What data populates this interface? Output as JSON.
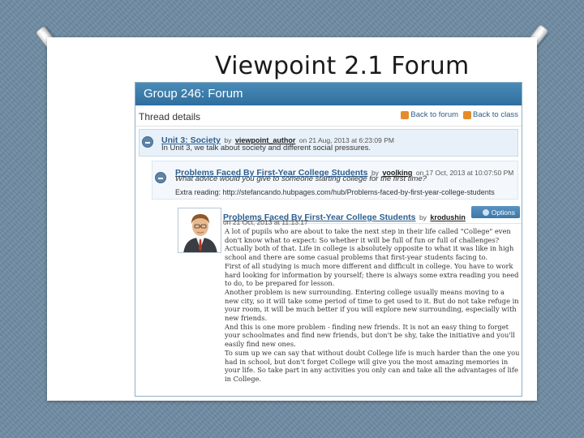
{
  "slide": {
    "title": "Viewpoint 2.1 Forum"
  },
  "forum": {
    "header": "Group 246: Forum",
    "thread_title": "Thread details",
    "nav": {
      "back_to_forum": "Back to forum",
      "back_to_class": "Back to class"
    }
  },
  "posts": [
    {
      "title": "Unit 3: Society",
      "by": "by",
      "author": "viewpoint_author",
      "date": "on 21 Aug, 2013 at 6:23:09 PM",
      "body": "In Unit 3, we talk about society and different social pressures."
    },
    {
      "title": "Problems Faced By First-Year College Students",
      "by": "by",
      "author": "voolking",
      "date": "on 17 Oct, 2013 at 10:07:50 PM",
      "question": "What advice would you give to someone starting college for the first time?",
      "extra": "Extra reading: http://stefancando.hubpages.com/hub/Problems-faced-by-first-year-college-students"
    },
    {
      "title": "Problems Faced By First-Year College Students",
      "by": "by",
      "author": "krodushin",
      "date": "on 21 Oct, 2013 at 11:13:17",
      "options": "Options",
      "paragraphs": [
        "A lot of pupils who are about to take the next step in their life called \"College\" even don't know what to expect: So whether it will be full of fun or full of challenges?",
        "Actually both of that. Life in college is absolutely opposite to what it was like in high school and there are some casual problems that first-year students facing to.",
        "First of all studying is much more different and difficult in college. You have to work hard looking for information by yourself; there is always some extra reading you need to do, to be prepared for lesson.",
        "Another problem is new surrounding. Entering college usually means moving to a new city, so it will take some period of time to get used to it. But do not take refuge in your room, it will be much better if you will explore new surrounding, especially with new friends.",
        "And this is one more problem - finding new friends. It is not an easy thing to forget your schoolmates and find new friends, but don't be shy, take the initiative and you'll easily find new ones.",
        "To sum up we can say that without doubt College life is much harder than the one you had in school, but don't forget College will give you the most amazing memories in your life. So take part in any activities you only can and take all the advantages of life in College."
      ]
    }
  ],
  "icons": {
    "nav_icon": "arrow-back-icon",
    "collapse_icon": "collapse-minus-icon",
    "options_icon": "options-gear-icon",
    "avatar": "user-avatar-businessman"
  },
  "colors": {
    "header": "#2f6f9f",
    "link": "#2e5f8f",
    "background": "#6f8ba3"
  }
}
